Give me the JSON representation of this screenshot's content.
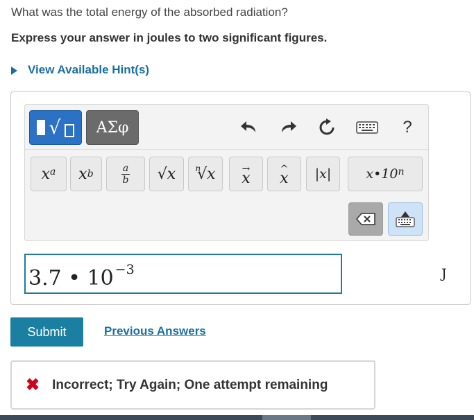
{
  "question": {
    "prompt": "What was the total energy of the absorbed radiation?",
    "instruction": "Express your answer in joules to two significant figures.",
    "hints_link": "View Available Hint(s)"
  },
  "toolbar": {
    "template_button": "√",
    "greek_button": "ΑΣφ",
    "help_label": "?",
    "tools": {
      "superscript_base": "x",
      "superscript_exp": "a",
      "subscript_base": "x",
      "subscript_sub": "b",
      "fraction_num": "a",
      "fraction_den": "b",
      "sqrt": "√x",
      "nth_root_index": "n",
      "nth_root": "√x",
      "vector": "x",
      "hat": "x",
      "absolute": "|x|",
      "sci_base": "x•10",
      "sci_exp": "n"
    }
  },
  "answer": {
    "mantissa": "3.7 • 10",
    "exponent": "−3",
    "unit": "J"
  },
  "actions": {
    "submit": "Submit",
    "previous_answers": "Previous Answers"
  },
  "feedback": {
    "icon": "✖",
    "message": "Incorrect; Try Again; One attempt remaining",
    "status_color": "#d0021b"
  },
  "colors": {
    "accent": "#1a7fa1",
    "link": "#1a6fa0",
    "template_active": "#2c72c4"
  }
}
